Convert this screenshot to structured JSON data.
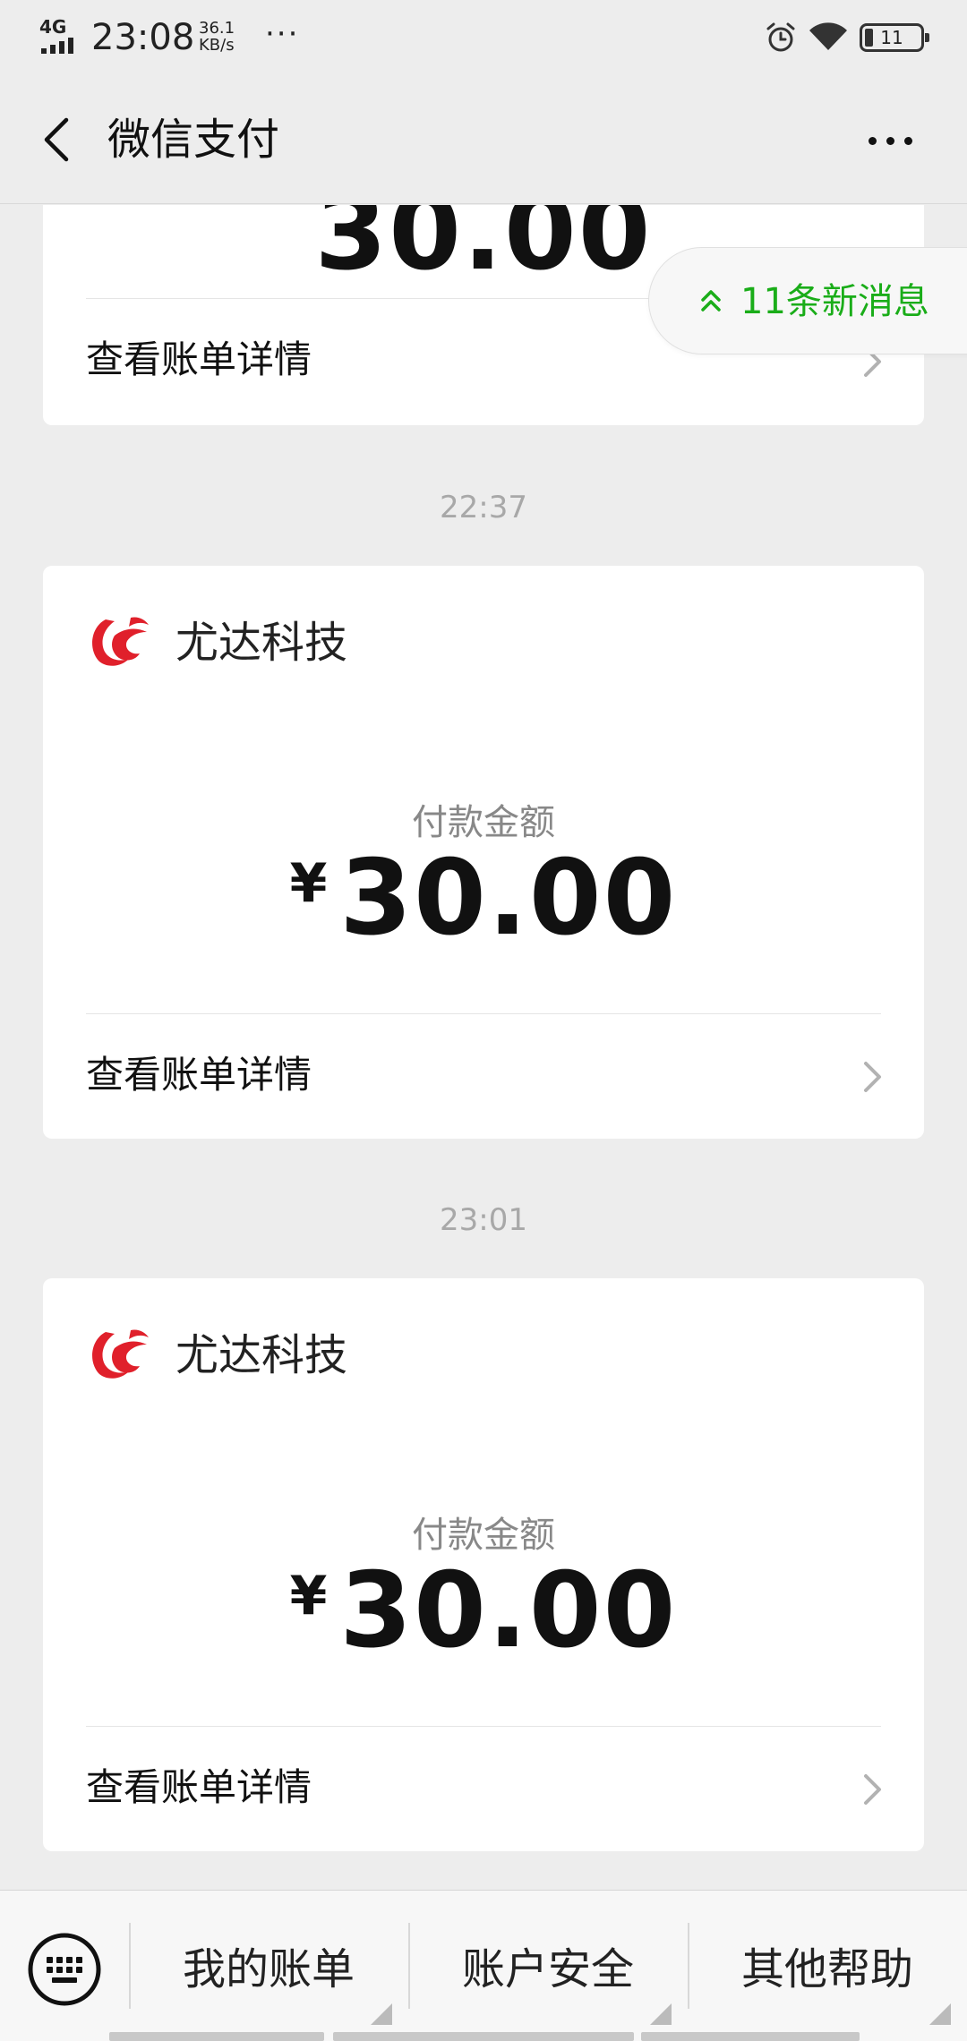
{
  "status_bar": {
    "network": "4G",
    "time": "23:08",
    "speed_value": "36.1",
    "speed_unit": "KB/s",
    "battery": "11"
  },
  "nav": {
    "title": "微信支付"
  },
  "new_messages_pill": {
    "label": "11条新消息"
  },
  "cards": [
    {
      "detail_label": "查看账单详情"
    },
    {
      "timestamp": "22:37",
      "merchant": "尤达科技",
      "amount_label": "付款金额",
      "currency": "¥",
      "amount": "30.00",
      "detail_label": "查看账单详情"
    },
    {
      "timestamp": "23:01",
      "merchant": "尤达科技",
      "amount_label": "付款金额",
      "currency": "¥",
      "amount": "30.00",
      "detail_label": "查看账单详情"
    }
  ],
  "bottom_menu": {
    "items": [
      {
        "label": "我的账单"
      },
      {
        "label": "账户安全"
      },
      {
        "label": "其他帮助"
      }
    ]
  },
  "colors": {
    "accent_green": "#1aad19",
    "logo_red": "#e0202b",
    "background": "#ededed"
  },
  "icons": {
    "back": "chevron-left-icon",
    "more": "more-dots-icon",
    "new_messages": "double-chevron-up-icon",
    "detail": "chevron-right-icon",
    "keyboard": "keyboard-icon",
    "alarm": "alarm-icon",
    "wifi": "wifi-icon",
    "battery": "battery-icon",
    "signal": "signal-icon"
  }
}
